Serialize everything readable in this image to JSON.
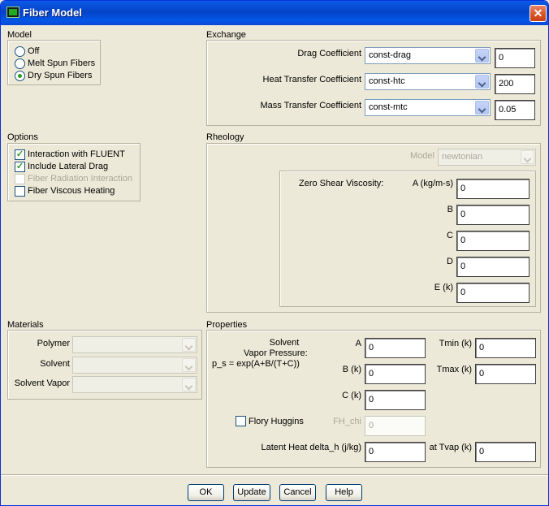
{
  "window": {
    "title": "Fiber Model",
    "close_glyph": "✕"
  },
  "model": {
    "label": "Model",
    "options": [
      {
        "label": "Off",
        "selected": false
      },
      {
        "label": "Melt Spun Fibers",
        "selected": false
      },
      {
        "label": "Dry Spun Fibers",
        "selected": true
      }
    ]
  },
  "options": {
    "label": "Options",
    "items": [
      {
        "label": "Interaction with FLUENT",
        "checked": true,
        "enabled": true
      },
      {
        "label": "Include Lateral Drag",
        "checked": true,
        "enabled": true
      },
      {
        "label": "Fiber Radiation Interaction",
        "checked": false,
        "enabled": false
      },
      {
        "label": "Fiber Viscous Heating",
        "checked": false,
        "enabled": true
      }
    ]
  },
  "materials": {
    "label": "Materials",
    "polymer_label": "Polymer",
    "solvent_label": "Solvent",
    "solvent_vapor_label": "Solvent Vapor",
    "polymer_value": "",
    "solvent_value": "",
    "solvent_vapor_value": ""
  },
  "exchange": {
    "label": "Exchange",
    "rows": [
      {
        "label": "Drag Coefficient",
        "method": "const-drag",
        "value": "0"
      },
      {
        "label": "Heat Transfer Coefficient",
        "method": "const-htc",
        "value": "200"
      },
      {
        "label": "Mass Transfer Coefficient",
        "method": "const-mtc",
        "value": "0.05"
      }
    ]
  },
  "rheology": {
    "label": "Rheology",
    "model_label": "Model",
    "model_value": "newtonian",
    "zero_shear_label": "Zero Shear Viscosity:",
    "a_label": "A (kg/m-s)",
    "a_value": "0",
    "b_label": "B",
    "b_value": "0",
    "c_label": "C",
    "c_value": "0",
    "d_label": "D",
    "d_value": "0",
    "e_label": "E (k)",
    "e_value": "0"
  },
  "properties": {
    "label": "Properties",
    "solvent_line1": "Solvent",
    "solvent_line2": "Vapor Pressure:",
    "solvent_line3": "p_s = exp(A+B/(T+C))",
    "a_label": "A",
    "a_value": "0",
    "b_label": "B (k)",
    "b_value": "0",
    "c_label": "C (k)",
    "c_value": "0",
    "tmin_label": "Tmin (k)",
    "tmin_value": "0",
    "tmax_label": "Tmax (k)",
    "tmax_value": "0",
    "flory_label": "Flory Huggins",
    "flory_checked": false,
    "fh_chi_label": "FH_chi",
    "fh_chi_value": "0",
    "latent_label": "Latent Heat  delta_h (j/kg)",
    "latent_value": "0",
    "tvap_label": "at Tvap (k)",
    "tvap_value": "0"
  },
  "buttons": {
    "ok": "OK",
    "update": "Update",
    "cancel": "Cancel",
    "help": "Help"
  }
}
